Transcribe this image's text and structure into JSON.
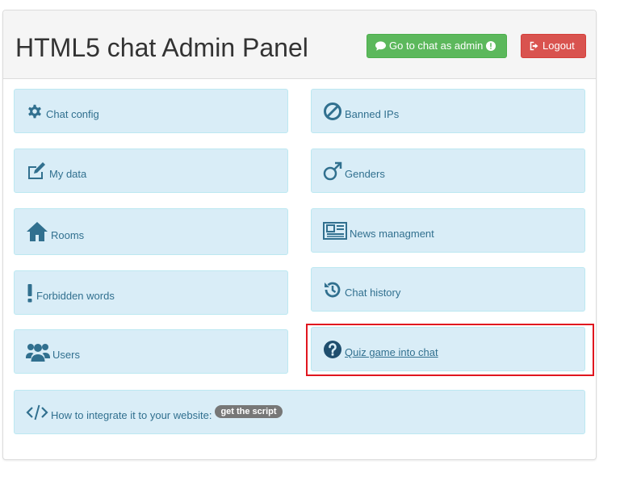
{
  "header": {
    "title": "HTML5 chat Admin Panel",
    "go_to_chat_label": "Go to chat as admin",
    "logout_label": "Logout"
  },
  "tiles": {
    "chat_config": {
      "label": "Chat config",
      "icon": "gear-icon"
    },
    "banned_ips": {
      "label": "Banned IPs",
      "icon": "ban-icon"
    },
    "my_data": {
      "label": "My data",
      "icon": "edit-icon"
    },
    "genders": {
      "label": "Genders",
      "icon": "male-icon"
    },
    "rooms": {
      "label": "Rooms",
      "icon": "home-icon"
    },
    "news": {
      "label": "News managment",
      "icon": "newspaper-icon"
    },
    "forbidden_words": {
      "label": "Forbidden words",
      "icon": "exclamation-icon"
    },
    "chat_history": {
      "label": "Chat history",
      "icon": "history-icon"
    },
    "users": {
      "label": "Users",
      "icon": "users-icon"
    },
    "quiz": {
      "label": "Quiz game into chat",
      "icon": "question-circle-icon"
    },
    "integrate": {
      "label": "How to integrate it to your website:",
      "badge": "get the script",
      "icon": "code-icon"
    }
  },
  "colors": {
    "tile_bg": "#d9edf7",
    "tile_text": "#31708f",
    "success": "#5cb85c",
    "danger": "#d9534f",
    "highlight": "#e0161f"
  }
}
